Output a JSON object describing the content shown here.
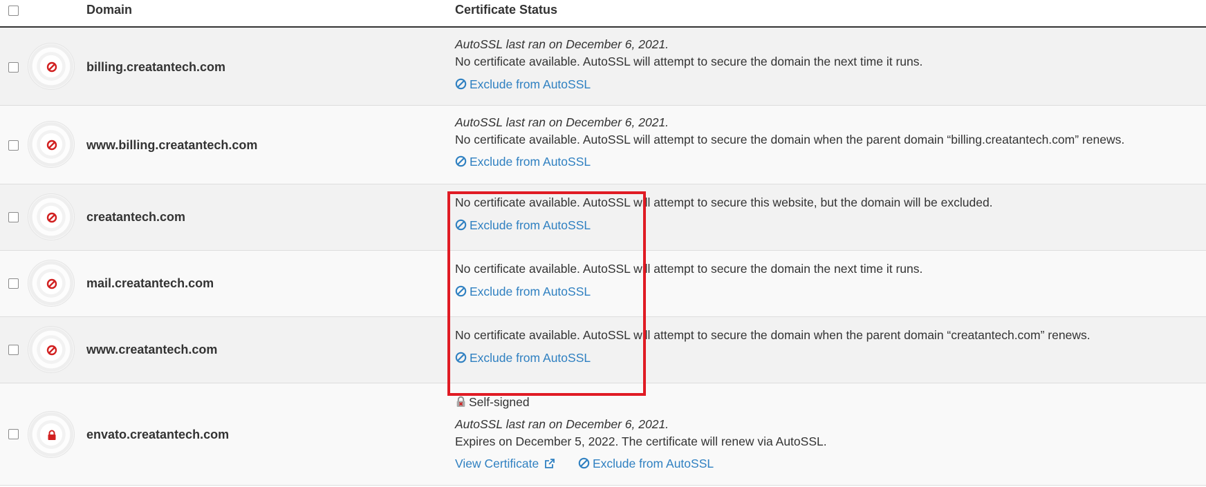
{
  "header": {
    "domain_label": "Domain",
    "status_label": "Certificate Status"
  },
  "colors": {
    "link": "#2f80c1",
    "error_icon": "#d11f1f",
    "highlight_box": "#e01b24"
  },
  "rows": [
    {
      "domain": "billing.creatantech.com",
      "icon": "no-entry-icon",
      "last_ran": "AutoSSL last ran on December 6, 2021.",
      "message": "No certificate available. AutoSSL will attempt to secure the domain the next time it runs.",
      "exclude_label": "Exclude from AutoSSL"
    },
    {
      "domain": "www.billing.creatantech.com",
      "icon": "no-entry-icon",
      "last_ran": "AutoSSL last ran on December 6, 2021.",
      "message": "No certificate available. AutoSSL will attempt to secure the domain when the parent domain “billing.creatantech.com” renews.",
      "exclude_label": "Exclude from AutoSSL"
    },
    {
      "domain": "creatantech.com",
      "icon": "no-entry-icon",
      "message": "No certificate available. AutoSSL will attempt to secure this website, but the domain will be excluded.",
      "exclude_label": "Exclude from AutoSSL"
    },
    {
      "domain": "mail.creatantech.com",
      "icon": "no-entry-icon",
      "message": "No certificate available. AutoSSL will attempt to secure the domain the next time it runs.",
      "exclude_label": "Exclude from AutoSSL"
    },
    {
      "domain": "www.creatantech.com",
      "icon": "no-entry-icon",
      "message": "No certificate available. AutoSSL will attempt to secure the domain when the parent domain “creatantech.com” renews.",
      "exclude_label": "Exclude from AutoSSL"
    },
    {
      "domain": "envato.creatantech.com",
      "icon": "lock-icon",
      "cert_type": "Self-signed",
      "last_ran": "AutoSSL last ran on December 6, 2021.",
      "message": "Expires on December 5, 2022. The certificate will renew via AutoSSL.",
      "view_label": "View Certificate",
      "exclude_label": "Exclude from AutoSSL"
    }
  ]
}
